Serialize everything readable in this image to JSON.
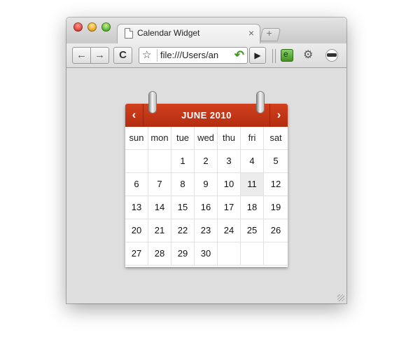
{
  "browser": {
    "tab_title": "Calendar Widget",
    "tab_close": "×",
    "new_tab": "+",
    "url": "file:///Users/an",
    "back": "←",
    "forward": "→",
    "reload": "C",
    "go": "▶"
  },
  "calendar": {
    "title": "JUNE 2010",
    "prev": "‹",
    "next": "›",
    "weekdays": [
      "sun",
      "mon",
      "tue",
      "wed",
      "thu",
      "fri",
      "sat"
    ],
    "weeks": [
      [
        "",
        "",
        "1",
        "2",
        "3",
        "4",
        "5"
      ],
      [
        "6",
        "7",
        "8",
        "9",
        "10",
        "11",
        "12"
      ],
      [
        "13",
        "14",
        "15",
        "16",
        "17",
        "18",
        "19"
      ],
      [
        "20",
        "21",
        "22",
        "23",
        "24",
        "25",
        "26"
      ],
      [
        "27",
        "28",
        "29",
        "30",
        "",
        "",
        ""
      ]
    ],
    "highlighted_day": "11",
    "colors": {
      "header": "#c0391a",
      "highlight": "#ececec"
    }
  }
}
